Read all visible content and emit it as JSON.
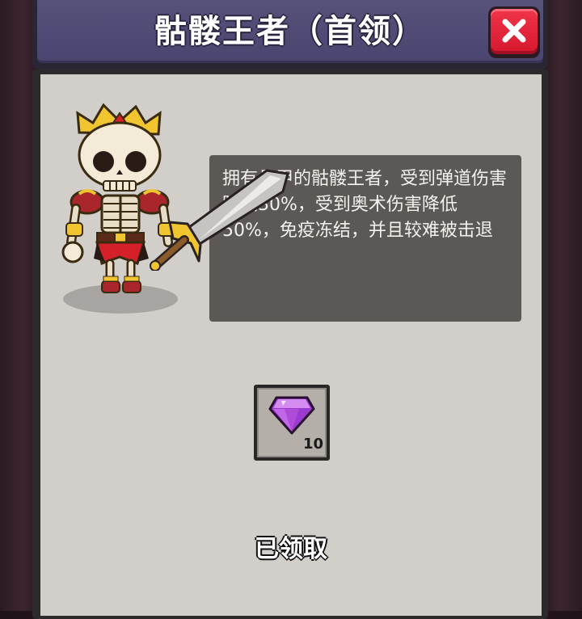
{
  "dialog": {
    "title": "骷髅王者（首领）",
    "close_icon": "close-x-icon"
  },
  "boss": {
    "portrait_icon": "skeleton-king-icon",
    "weapon_icon": "sword-icon",
    "description": "拥有骨甲的骷髅王者，受到弹道伤害降低30%，受到奥术伤害降低50%，免疫冻结，并且较难被击退"
  },
  "reward": {
    "icon": "purple-gem-icon",
    "count": "10"
  },
  "status": {
    "claimed_label": "已领取"
  },
  "colors": {
    "title_bar": "#4a4570",
    "panel": "#d2cfcb",
    "desc_box": "#5b5855",
    "close_button": "#e22a3e",
    "gem": "#b04ad8"
  }
}
